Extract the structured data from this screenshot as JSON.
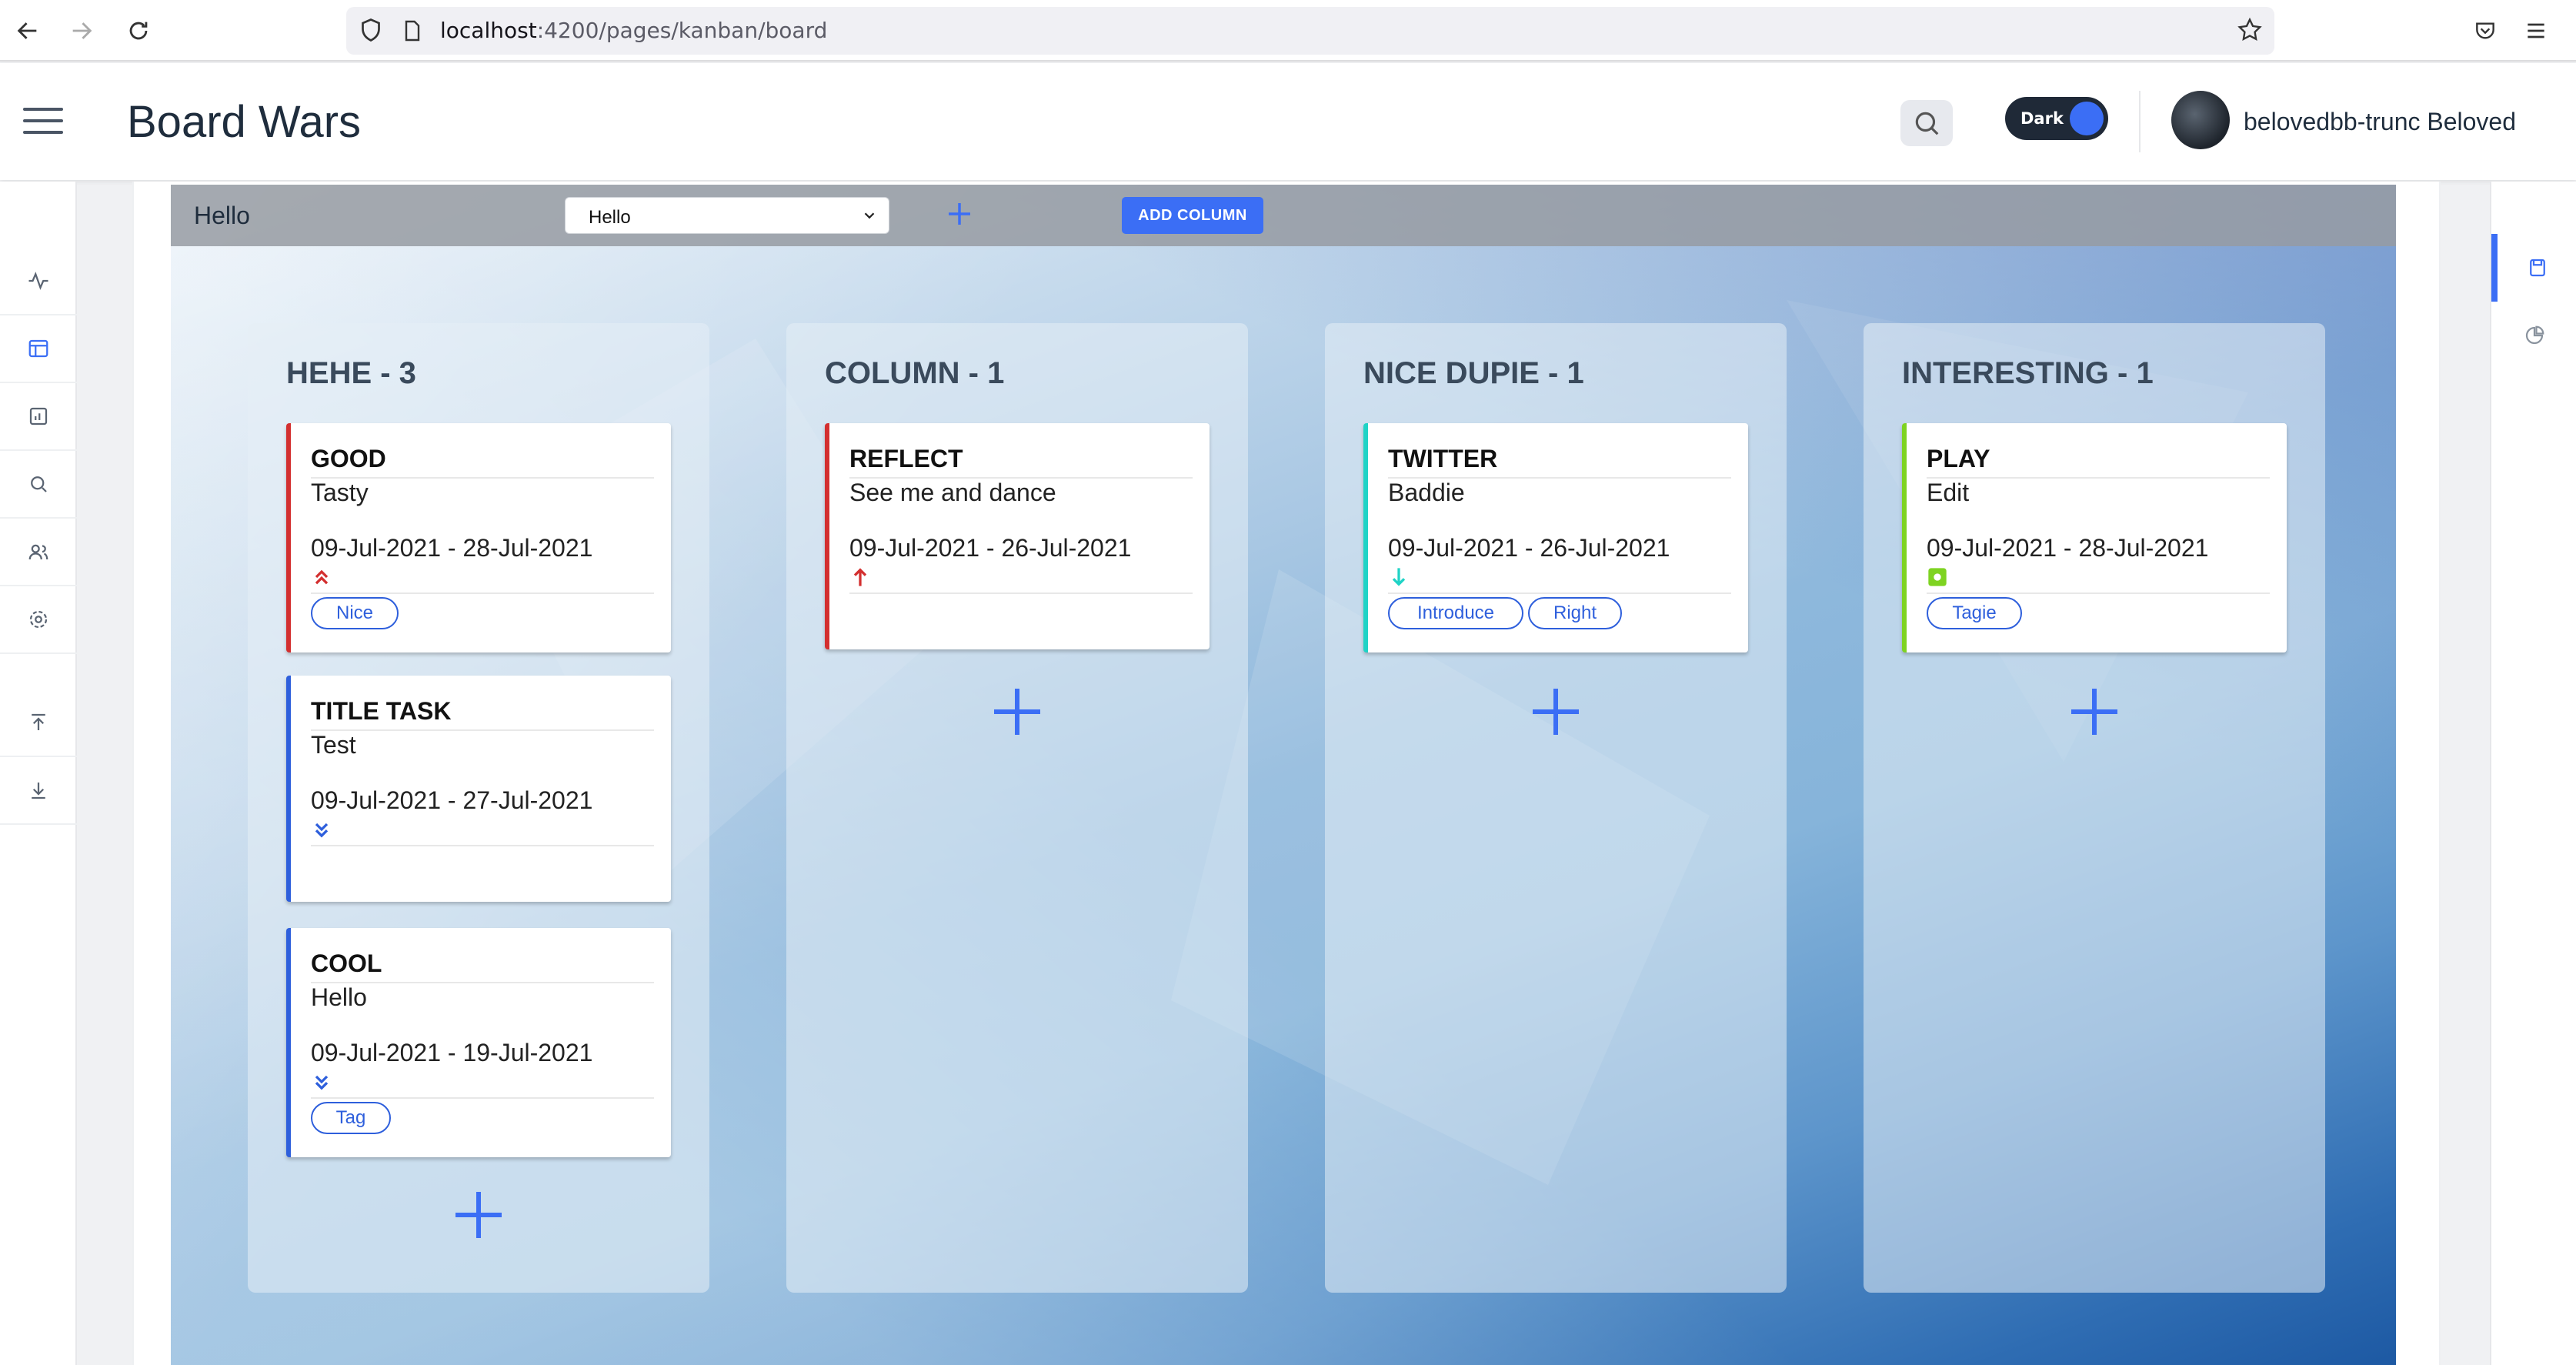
{
  "browser": {
    "url_host": "localhost",
    "url_path": ":4200/pages/kanban/board"
  },
  "header": {
    "app_title": "Board Wars",
    "theme_toggle_label": "Dark",
    "user_name": "belovedbb-trunc Beloved"
  },
  "toolbar": {
    "board_name": "Hello",
    "board_select_value": "Hello",
    "add_column_label": "ADD COLUMN"
  },
  "left_sidebar": [
    "activity-icon",
    "board-icon",
    "report-icon",
    "search-icon",
    "users-icon",
    "settings-icon",
    "upload-icon",
    "download-icon"
  ],
  "right_sidebar": [
    "save-icon",
    "pie-chart-icon"
  ],
  "colors": {
    "accent": "#3b6ef5",
    "priority_high": "#d32f2f",
    "priority_low": "#2e5fdc",
    "priority_down": "#1fd3c6",
    "priority_normal": "#7ed321"
  },
  "columns": [
    {
      "title": "HEHE - 3",
      "cards": [
        {
          "title": "GOOD",
          "desc": "Tasty",
          "date": "09-Jul-2021 - 28-Jul-2021",
          "priority_icon": "double-chevron-up-icon",
          "tags": [
            "Nice"
          ]
        },
        {
          "title": "TITLE TASK",
          "desc": "Test",
          "date": "09-Jul-2021 - 27-Jul-2021",
          "priority_icon": "double-chevron-down-icon",
          "tags": []
        },
        {
          "title": "COOL",
          "desc": "Hello",
          "date": "09-Jul-2021 - 19-Jul-2021",
          "priority_icon": "double-chevron-down-icon",
          "tags": [
            "Tag"
          ]
        }
      ]
    },
    {
      "title": "COLUMN - 1",
      "cards": [
        {
          "title": "REFLECT",
          "desc": "See me and dance",
          "date": "09-Jul-2021 - 26-Jul-2021",
          "priority_icon": "arrow-up-icon",
          "tags": []
        }
      ]
    },
    {
      "title": "NICE DUPIE - 1",
      "cards": [
        {
          "title": "TWITTER",
          "desc": "Baddie",
          "date": "09-Jul-2021 - 26-Jul-2021",
          "priority_icon": "arrow-down-icon",
          "tags": [
            "Introduce",
            "Right"
          ]
        }
      ]
    },
    {
      "title": "INTERESTING - 1",
      "cards": [
        {
          "title": "PLAY",
          "desc": "Edit",
          "date": "09-Jul-2021 - 28-Jul-2021",
          "priority_icon": "dot-square-icon",
          "tags": [
            "Tagie"
          ]
        }
      ]
    }
  ]
}
